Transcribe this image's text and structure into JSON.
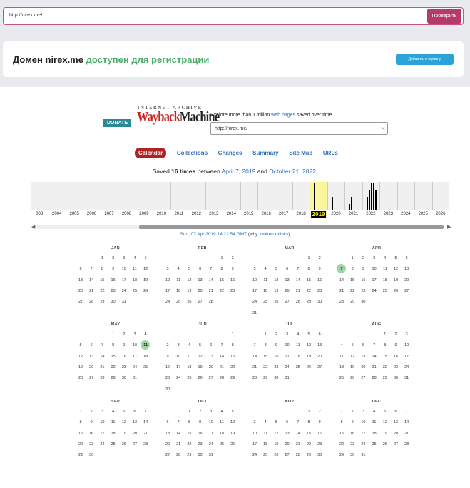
{
  "topbar": {
    "url_value": "http://nirex.me/",
    "check_label": "Проверить"
  },
  "banner": {
    "domain": "Домен nirex.me",
    "available": "доступен для регистрации",
    "cart_label": "Добавить в корзину"
  },
  "wayback": {
    "donate_label": "DONATE",
    "ia_label": "INTERNET ARCHIVE",
    "logo_part1": "Wayback",
    "logo_part2": "Machine",
    "explore_pre": "Explore more than 1 trillion ",
    "explore_link": "web pages",
    "explore_post": " saved over time",
    "search_value": "http://nirex.me/",
    "clear_icon": "×",
    "nav": [
      "Calendar",
      "Collections",
      "Changes",
      "Summary",
      "Site Map",
      "URLs"
    ],
    "saved_pre": "Saved ",
    "saved_count": "16 times",
    "saved_mid": " between ",
    "saved_first": "April 7, 2019",
    "saved_and": " and ",
    "saved_last": "October 21, 2022.",
    "years": [
      "003",
      "2004",
      "2005",
      "2006",
      "2007",
      "2008",
      "2009",
      "2010",
      "2011",
      "2012",
      "2013",
      "2014",
      "2015",
      "2016",
      "2017",
      "2018",
      "2019",
      "2020",
      "2021",
      "2022",
      "2023",
      "2024",
      "2025",
      "2026"
    ],
    "selected_year": "2019",
    "capture_info": "Sun, 07 Apr 2019 14:22:54 GMT",
    "capture_why_pre": " (why: ",
    "capture_why": "twitteroutlinks",
    "capture_why_post": ")"
  },
  "calendar": {
    "months": [
      {
        "name": "JAN",
        "start": 2,
        "days": 31,
        "captured": []
      },
      {
        "name": "FEB",
        "start": 5,
        "days": 28,
        "captured": []
      },
      {
        "name": "MAR",
        "start": 5,
        "days": 31,
        "captured": []
      },
      {
        "name": "APR",
        "start": 1,
        "days": 30,
        "captured": [
          7
        ]
      },
      {
        "name": "MAY",
        "start": 3,
        "days": 31,
        "captured": [
          11
        ]
      },
      {
        "name": "JUN",
        "start": 6,
        "days": 30,
        "captured": []
      },
      {
        "name": "JUL",
        "start": 1,
        "days": 31,
        "captured": []
      },
      {
        "name": "AUG",
        "start": 4,
        "days": 31,
        "captured": []
      },
      {
        "name": "SEP",
        "start": 0,
        "days": 30,
        "captured": []
      },
      {
        "name": "OCT",
        "start": 2,
        "days": 31,
        "captured": []
      },
      {
        "name": "NOV",
        "start": 5,
        "days": 30,
        "captured": []
      },
      {
        "name": "DEC",
        "start": 0,
        "days": 31,
        "captured": []
      }
    ]
  },
  "histogram_captures": {
    "2019": [
      4
    ],
    "2020": [
      2
    ],
    "2021": [
      1,
      2
    ],
    "2022": [
      2,
      3,
      4,
      4,
      3
    ]
  }
}
